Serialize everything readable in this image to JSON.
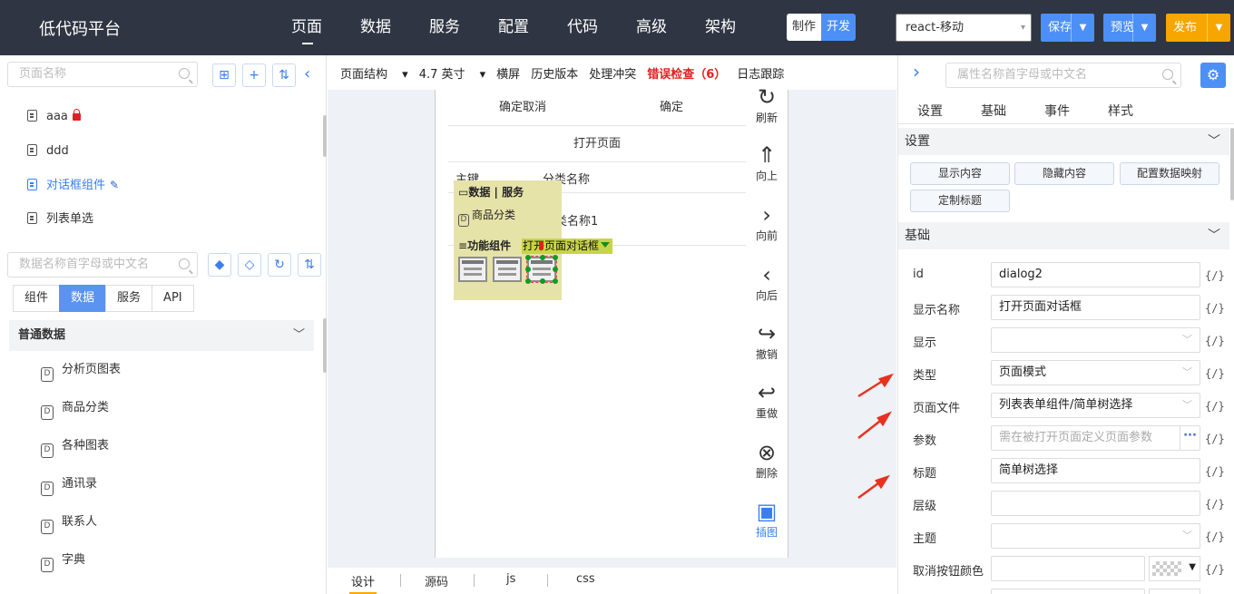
{
  "app": {
    "title": "低代码平台"
  },
  "nav": [
    "页面",
    "数据",
    "服务",
    "配置",
    "代码",
    "高级",
    "架构"
  ],
  "mode": {
    "make": "制作",
    "dev": "开发"
  },
  "platform": "react-移动",
  "actions": {
    "save": "保存",
    "preview": "预览",
    "publish": "发布"
  },
  "left": {
    "page_search_placeholder": "页面名称",
    "pages": [
      "aaa",
      "ddd",
      "对话框组件",
      "列表单选"
    ],
    "data_search_placeholder": "数据名称首字母或中文名",
    "tabs": [
      "组件",
      "数据",
      "服务",
      "API"
    ],
    "section": "普通数据",
    "data_items": [
      "分析页图表",
      "商品分类",
      "各种图表",
      "通讯录",
      "联系人",
      "字典"
    ]
  },
  "toolbar": {
    "page_structure": "页面结构",
    "size": "4.7 英寸",
    "landscape": "横屏",
    "history": "历史版本",
    "conflict": "处理冲突",
    "error_check": "错误检查（6）",
    "log": "日志跟踪"
  },
  "canvas": {
    "cancel": "确定取消",
    "ok": "确定",
    "open_page": "打开页面",
    "col_key": "主键",
    "col_name": "分类名称",
    "row_value": "类名称1",
    "popup": {
      "group1": "数据 | 服务",
      "item1": "商品分类",
      "group2": "功能组件"
    },
    "tag": "打开页面对话框"
  },
  "tools": [
    "刷新",
    "向上",
    "向前",
    "向后",
    "撤销",
    "重做",
    "删除",
    "插图"
  ],
  "bottom_tabs": [
    "设计",
    "源码",
    "js",
    "css"
  ],
  "right": {
    "search_placeholder": "属性名称首字母或中文名",
    "tabs": [
      "设置",
      "基础",
      "事件",
      "样式"
    ],
    "settings_section": "设置",
    "buttons": [
      "显示内容",
      "隐藏内容",
      "配置数据映射",
      "定制标题"
    ],
    "basic_section": "基础",
    "props": [
      {
        "label": "id",
        "value": "dialog2"
      },
      {
        "label": "显示名称",
        "value": "打开页面对话框"
      },
      {
        "label": "显示",
        "value": ""
      },
      {
        "label": "类型",
        "value": "页面模式"
      },
      {
        "label": "页面文件",
        "value": "列表表单组件/简单树选择"
      },
      {
        "label": "参数",
        "value": "需在被打开页面定义页面参数"
      },
      {
        "label": "标题",
        "value": "简单树选择"
      },
      {
        "label": "层级",
        "value": ""
      },
      {
        "label": "主题",
        "value": ""
      },
      {
        "label": "取消按钮颜色",
        "value": ""
      }
    ],
    "expr": "{/}"
  },
  "colors": {
    "accent": "#4c8ff6",
    "publish": "#f7a600",
    "error": "#e02020",
    "arrow": "#e8321e"
  }
}
